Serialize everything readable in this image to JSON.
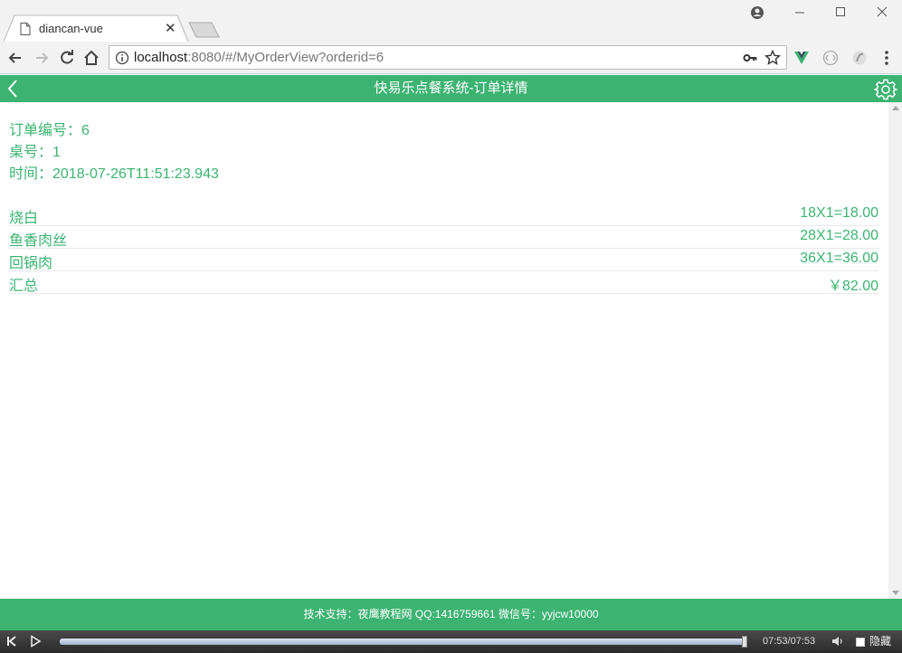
{
  "browser": {
    "tab_title": "diancan-vue",
    "url_host": "localhost",
    "url_rest": ":8080/#/MyOrderView?orderid=6"
  },
  "app": {
    "title": "快易乐点餐系统-订单详情"
  },
  "order": {
    "number_label": "订单编号：",
    "number": "6",
    "table_label": "桌号：",
    "table": "1",
    "time_label": "时间：",
    "time": "2018-07-26T11:51:23.943",
    "items": [
      {
        "name": "烧白",
        "price": "18X1=18.00"
      },
      {
        "name": "鱼香肉丝",
        "price": "28X1=28.00"
      },
      {
        "name": "回锅肉",
        "price": "36X1=36.00"
      }
    ],
    "total_label": "汇总",
    "total": "￥82.00"
  },
  "footer": {
    "text": "技术支持：夜鹰教程网 QQ:1416759661 微信号：yyjcw10000"
  },
  "player": {
    "time": "07:53/07:53",
    "hide_label": "隐藏",
    "progress": 1.0
  },
  "colors": {
    "accent": "#3cb371"
  }
}
